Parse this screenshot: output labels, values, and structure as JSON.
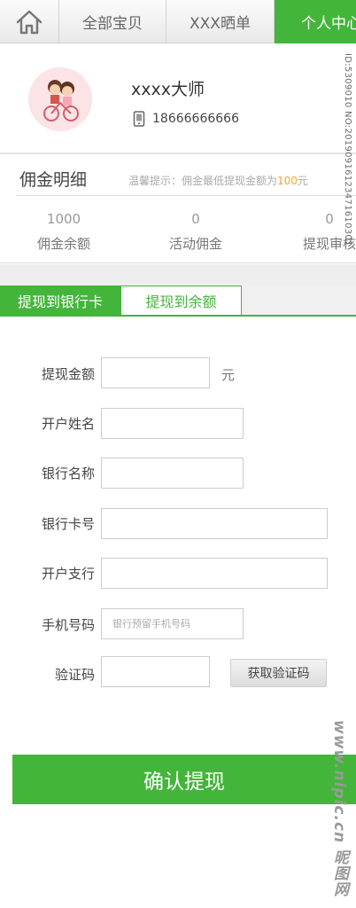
{
  "nav": {
    "home_icon": "home-icon",
    "tabs": [
      {
        "label": "全部宝贝"
      },
      {
        "label": "XXX晒单"
      },
      {
        "label": "个人中心"
      }
    ]
  },
  "profile": {
    "name": "xxxx大师",
    "phone_icon": "mobile-phone-icon",
    "phone": "18666666666"
  },
  "commission": {
    "title": "佣金明细",
    "hint_prefix": "温馨提示：佣金最低提现金额为",
    "hint_amount": "100",
    "hint_suffix": "元",
    "stats": [
      {
        "value": "1000",
        "label": "佣金余额"
      },
      {
        "value": "0",
        "label": "活动佣金"
      },
      {
        "value": "0",
        "label": "提现审核"
      }
    ]
  },
  "withdraw_tabs": [
    {
      "label": "提现到银行卡",
      "active": true
    },
    {
      "label": "提现到余额",
      "active": false
    }
  ],
  "form": {
    "amount_label": "提现金额",
    "amount_unit": "元",
    "holder_label": "开户姓名",
    "bank_label": "银行名称",
    "card_label": "银行卡号",
    "branch_label": "开户支行",
    "phone_label": "手机号码",
    "phone_placeholder": "银行预留手机号码",
    "code_label": "验证码",
    "get_code_button": "获取验证码"
  },
  "confirm_button": "确认提现",
  "watermark": {
    "id_text": "ID:5309010 NO:20190916123471610301",
    "brand_text": "www.nipic.cn 昵图网"
  },
  "colors": {
    "accent": "#43b53b",
    "hint_amount": "#f5a623"
  }
}
